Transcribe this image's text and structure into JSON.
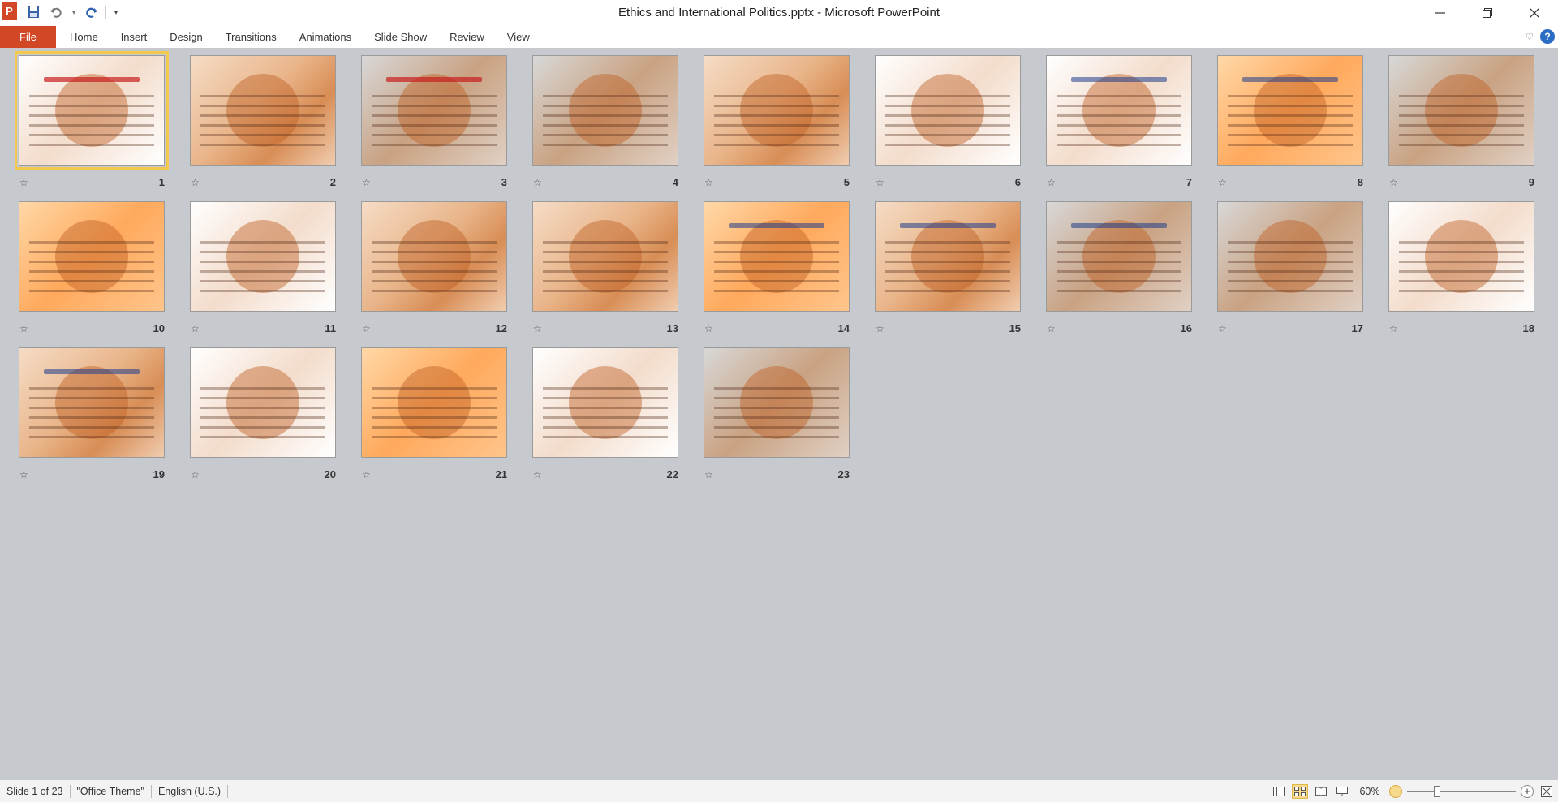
{
  "window": {
    "title": "Ethics and International Politics.pptx  -  Microsoft PowerPoint",
    "app_icon_letter": "P"
  },
  "ribbon": {
    "file_label": "File",
    "tabs": [
      "Home",
      "Insert",
      "Design",
      "Transitions",
      "Animations",
      "Slide Show",
      "Review",
      "View"
    ]
  },
  "slides": [
    {
      "num": "1",
      "style": "white",
      "heading": "red"
    },
    {
      "num": "2",
      "style": "base",
      "heading": ""
    },
    {
      "num": "3",
      "style": "gray",
      "heading": "red"
    },
    {
      "num": "4",
      "style": "gray",
      "heading": ""
    },
    {
      "num": "5",
      "style": "base",
      "heading": ""
    },
    {
      "num": "6",
      "style": "white",
      "heading": ""
    },
    {
      "num": "7",
      "style": "white",
      "heading": "blue"
    },
    {
      "num": "8",
      "style": "bright",
      "heading": "blue"
    },
    {
      "num": "9",
      "style": "gray",
      "heading": ""
    },
    {
      "num": "10",
      "style": "bright",
      "heading": ""
    },
    {
      "num": "11",
      "style": "white",
      "heading": ""
    },
    {
      "num": "12",
      "style": "base",
      "heading": ""
    },
    {
      "num": "13",
      "style": "base",
      "heading": ""
    },
    {
      "num": "14",
      "style": "bright",
      "heading": "blue"
    },
    {
      "num": "15",
      "style": "base",
      "heading": "blue"
    },
    {
      "num": "16",
      "style": "gray",
      "heading": "blue"
    },
    {
      "num": "17",
      "style": "gray",
      "heading": ""
    },
    {
      "num": "18",
      "style": "white",
      "heading": ""
    },
    {
      "num": "19",
      "style": "base",
      "heading": "blue"
    },
    {
      "num": "20",
      "style": "white",
      "heading": ""
    },
    {
      "num": "21",
      "style": "bright",
      "heading": ""
    },
    {
      "num": "22",
      "style": "white",
      "heading": ""
    },
    {
      "num": "23",
      "style": "gray",
      "heading": ""
    }
  ],
  "selected_slide": "1",
  "status": {
    "slide_info": "Slide 1 of 23",
    "theme": "\"Office Theme\"",
    "language": "English (U.S.)",
    "zoom": "60%",
    "zoom_fraction": 0.6
  },
  "colors": {
    "file_tab": "#d24726",
    "selection": "#f2c94c",
    "sorter_bg": "#c6cacf"
  }
}
